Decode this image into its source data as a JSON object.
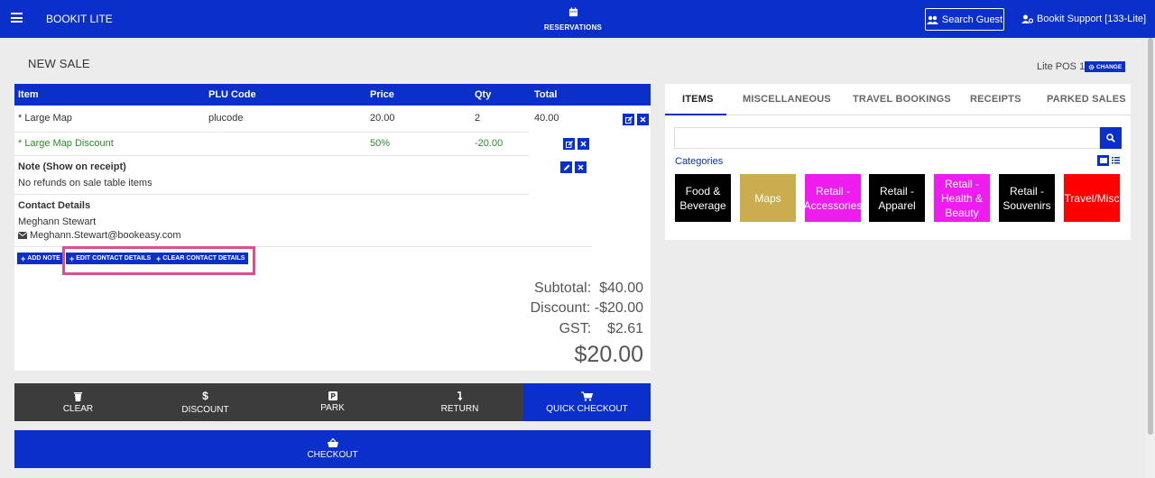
{
  "header": {
    "brand": "BOOKIT LITE",
    "nav_reservations": "RESERVATIONS",
    "search_guest": "Search Guest",
    "user": "Bookit Support [133-Lite]"
  },
  "page": {
    "title": "NEW SALE",
    "pos_label": "Lite POS 1",
    "change_label": "CHANGE"
  },
  "sale_table": {
    "columns": [
      "Item",
      "PLU Code",
      "Price",
      "Qty",
      "Total"
    ],
    "rows": [
      {
        "item": "* Large Map",
        "plu": "plucode",
        "price": "20.00",
        "qty": "2",
        "total": "40.00"
      },
      {
        "item": "* Large Map Discount",
        "plu": "",
        "price": "50%",
        "qty": "-20.00",
        "total": ""
      }
    ]
  },
  "note": {
    "heading": "Note (Show on receipt)",
    "text": "No refunds on sale table items"
  },
  "contact": {
    "heading": "Contact Details",
    "name": "Meghann Stewart",
    "email": "Meghann.Stewart@bookeasy.com"
  },
  "buttons": {
    "add_note": "ADD NOTE",
    "edit_contact": "EDIT CONTACT DETAILS",
    "clear_contact": "CLEAR CONTACT DETAILS"
  },
  "totals": {
    "subtotal_label": "Subtotal:",
    "subtotal": "$40.00",
    "discount_label": "Discount:",
    "discount": "-$20.00",
    "gst_label": "GST:",
    "gst": "$2.61",
    "grand_total": "$20.00"
  },
  "actions": {
    "clear": "CLEAR",
    "discount": "DISCOUNT",
    "park": "PARK",
    "return": "RETURN",
    "quick_checkout": "QUICK CHECKOUT",
    "checkout": "CHECKOUT"
  },
  "right_tabs": [
    "ITEMS",
    "MISCELLANEOUS",
    "TRAVEL BOOKINGS",
    "RECEIPTS",
    "PARKED SALES"
  ],
  "search": {
    "placeholder": ""
  },
  "categories_label": "Categories",
  "categories": [
    {
      "label": "Food &\nBeverage",
      "bg": "#000000",
      "fg": "#ffffff"
    },
    {
      "label": "Maps",
      "bg": "#c9ad4f",
      "fg": "#ffffff"
    },
    {
      "label": "Retail -\nAccessories",
      "bg": "#ee1cee",
      "fg": "#ffffff"
    },
    {
      "label": "Retail -\nApparel",
      "bg": "#000000",
      "fg": "#ffffff"
    },
    {
      "label": "Retail -\nHealth &\nBeauty",
      "bg": "#ee1cee",
      "fg": "#ffffff"
    },
    {
      "label": "Retail -\nSouvenirs",
      "bg": "#000000",
      "fg": "#ffffff"
    },
    {
      "label": "Travel/Misc",
      "bg": "#ff0000",
      "fg": "#ffffff"
    }
  ],
  "colors": {
    "brand": "#0a2fcb",
    "action_dark": "#3c3c3c",
    "highlight": "#d94f8f",
    "discount_green": "#2a8f2a"
  }
}
